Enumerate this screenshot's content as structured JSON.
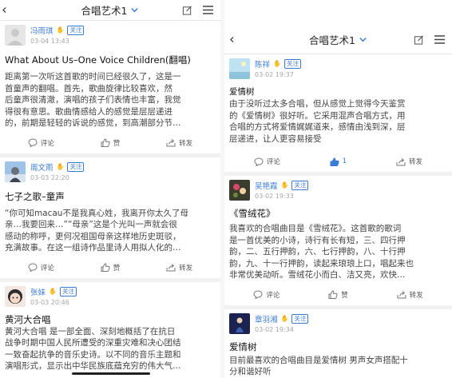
{
  "colors": {
    "accent": "#3a7bd5",
    "like_active": "#3a7bd5",
    "text": "#222222",
    "muted": "#a5a5a5"
  },
  "left": {
    "header": {
      "title": "合唱艺术1",
      "back_icon": "chevron-left-icon",
      "edit_icon": "edit-icon",
      "menu_icon": "hamburger-menu-icon"
    },
    "posts": [
      {
        "name": "冯雨琪",
        "follow": "关注",
        "date": "03-04 13:43",
        "title": "What About Us–One Voice Children(翻唱)",
        "body": [
          "距离第一次听这首歌的时间已经很久了，这是一",
          "首童声的翻唱。首先，歌曲旋律比较喜欢，然",
          "后童声很清澈，演唱的孩子们表情也丰富，我觉",
          "得很有意思。歌曲情感给人的感觉是层层递进",
          "的，前期是轻轻的诉说的感觉，到高潮部分节…"
        ],
        "actions": {
          "comment": "评论",
          "like": "赞",
          "share": "转发"
        }
      },
      {
        "name": "周文雨",
        "follow": "关注",
        "date": "03-03 22:20",
        "title": "七子之歌–童声",
        "body": [
          "“你可知macau不是我真心姓，我离开你太久了母",
          "亲…我要回来…”“母亲”这是个光叫一声就会很",
          "感动的称呼，更何况祖国母亲这样地历史斑驳，",
          "充满故事。在这一组诗作品里诗人用拟人化的…"
        ],
        "actions": {
          "comment": "评论",
          "like": "赞",
          "share": "转发"
        }
      },
      {
        "name": "张妹",
        "follow": "关注",
        "date": "03-03 20:46",
        "title": "黄河大合唱",
        "body": [
          "黄河大合唱 是一部全面、深刻地概括了在抗日",
          "战争时期中国人民所遭受的深重灾难和决心团结",
          "一致奋起抗争的音乐史诗。以不同的音乐主题和",
          "演唱形式，显示出中华民族底蕴充穷的伟大气…"
        ]
      }
    ]
  },
  "right": {
    "header": {
      "title": "合唱艺术1",
      "back_icon": "chevron-left-icon",
      "edit_icon": "edit-icon",
      "menu_icon": "hamburger-menu-icon"
    },
    "posts": [
      {
        "name": "陈祥",
        "follow": "关注",
        "date": "03-02 19:37",
        "title": "爱情树",
        "body": [
          "由于没听过太多合唱，但从感觉上觉得今天鉴赏",
          "的《爱情树》很好听。它采用混声合唱方式，用",
          "合唱的方式将爱情娓娓道来，感情由浅到深，层",
          "层递进，让人更容易接受"
        ],
        "actions": {
          "comment": "评论",
          "like": "1",
          "share": "转发",
          "liked": true
        }
      },
      {
        "name": "吴艳霞",
        "follow": "关注",
        "date": "03-02 19:33",
        "title": "《雪绒花》",
        "body": [
          "我喜欢的合唱曲目是《雪绒花》。这首歌的歌词",
          "是一首优美的小诗，诗行有长有短，三、四行押",
          "韵，二、五行押韵，六、七行押韵，八、十行押",
          "韵，九、十一行押韵，读起来琅琅上口，唱起来也",
          "非常优美动听。雪绒花小而白、洁又亮，欢快…"
        ],
        "actions": {
          "comment": "评论",
          "like": "赞",
          "share": "转发"
        }
      },
      {
        "name": "章羽湘",
        "follow": "关注",
        "date": "03-02 19:34",
        "title": "爱情树",
        "body": [
          "目前最喜欢的合唱曲目是爱情树 男声女声搭配十",
          "分和谐好听"
        ]
      }
    ]
  }
}
